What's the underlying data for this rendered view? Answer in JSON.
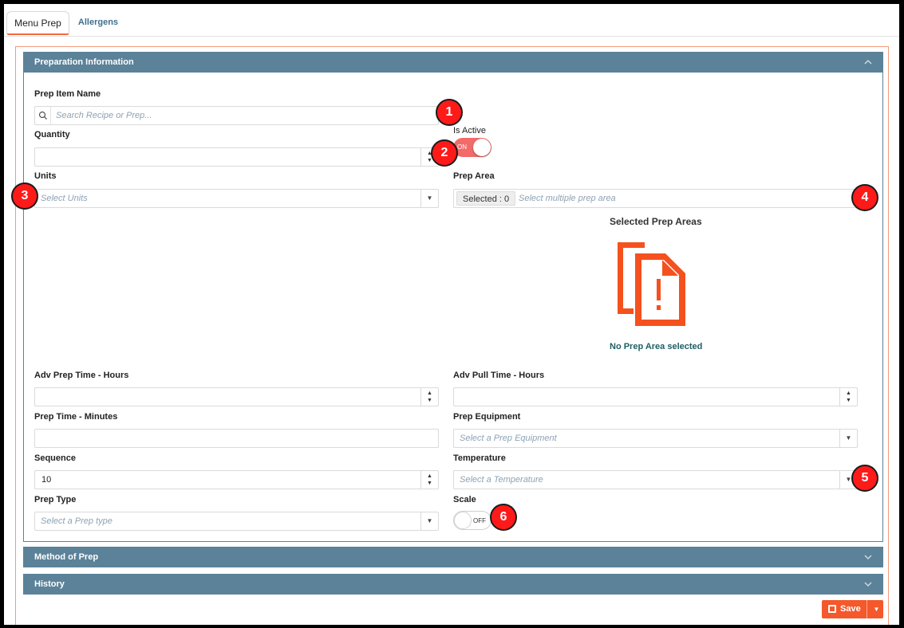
{
  "tabs": {
    "menu_prep": "Menu Prep",
    "allergens": "Allergens"
  },
  "sections": {
    "preparation": "Preparation Information",
    "method": "Method of Prep",
    "history": "History"
  },
  "form": {
    "prep_item_name": {
      "label": "Prep Item Name",
      "placeholder": "Search Recipe or Prep..."
    },
    "quantity": {
      "label": "Quantity",
      "value": ""
    },
    "is_active": {
      "label": "Is Active",
      "state": "ON"
    },
    "units": {
      "label": "Units",
      "placeholder": "Select Units"
    },
    "prep_area": {
      "label": "Prep Area",
      "selected_badge": "Selected : 0",
      "placeholder": "Select multiple prep area"
    },
    "selected_prep_areas": {
      "title": "Selected Prep Areas",
      "empty_text": "No Prep Area selected"
    },
    "adv_prep_time": {
      "label": "Adv Prep Time - Hours",
      "value": ""
    },
    "adv_pull_time": {
      "label": "Adv Pull Time - Hours",
      "value": ""
    },
    "prep_time": {
      "label": "Prep Time - Minutes",
      "value": ""
    },
    "prep_equipment": {
      "label": "Prep Equipment",
      "placeholder": "Select a Prep Equipment"
    },
    "sequence": {
      "label": "Sequence",
      "value": "10"
    },
    "temperature": {
      "label": "Temperature",
      "placeholder": "Select a Temperature"
    },
    "prep_type": {
      "label": "Prep Type",
      "placeholder": "Select a Prep type"
    },
    "scale": {
      "label": "Scale",
      "state": "OFF"
    }
  },
  "actions": {
    "save": "Save"
  },
  "callouts": [
    "1",
    "2",
    "3",
    "4",
    "5",
    "6"
  ],
  "icons": {
    "search": "search-icon",
    "spinner_up": "▲",
    "spinner_down": "▼",
    "dropdown": "▼",
    "collapse": "chevron-up-icon",
    "expand": "chevron-down-icon",
    "empty_state": "documents-alert-icon",
    "save": "floppy-icon"
  },
  "colors": {
    "accent": "#f4582b",
    "header_bg": "#5b8299",
    "toggle_on": "#f26a6a",
    "empty_icon": "#f4511e",
    "empty_text": "#1f5f63",
    "callout": "#ff1a1a"
  }
}
